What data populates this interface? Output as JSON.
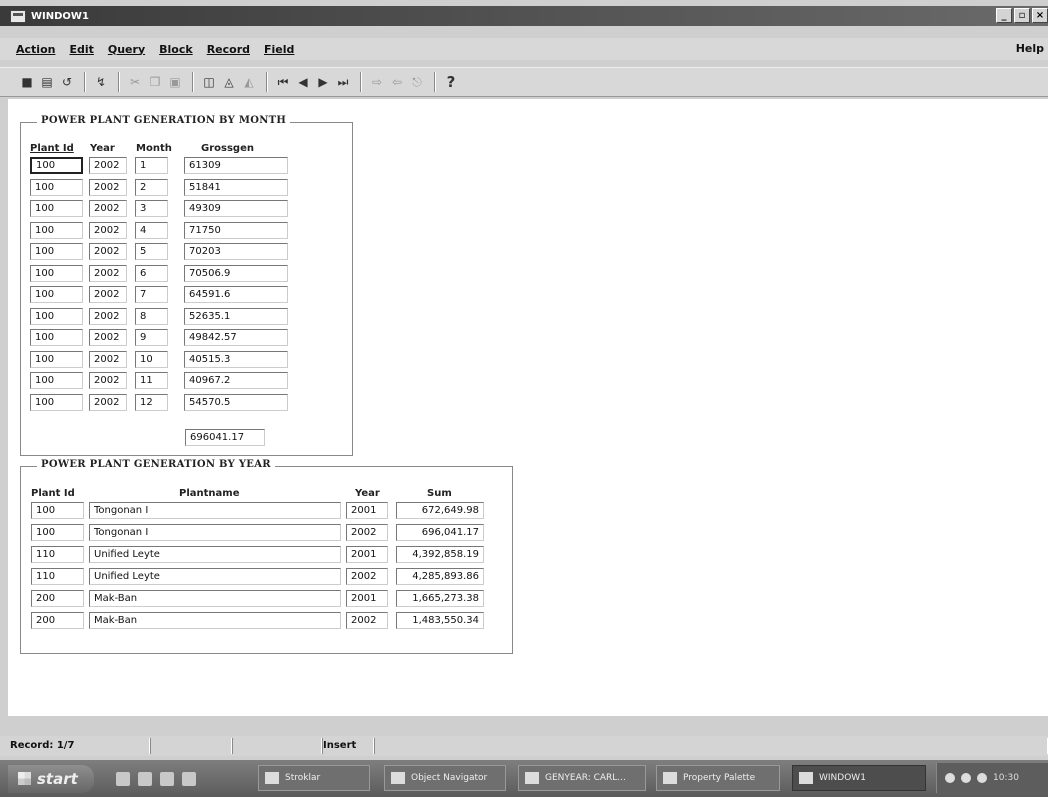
{
  "window": {
    "title": "WINDOW1",
    "btn_min": "_",
    "btn_max": "▫",
    "btn_close": "×"
  },
  "menu": {
    "items": [
      "Action",
      "Edit",
      "Query",
      "Block",
      "Record",
      "Field"
    ],
    "help": "Help"
  },
  "toolbar": {
    "icons": [
      "save-icon",
      "print-icon",
      "exit-icon",
      "insert-record-icon",
      "cut-icon",
      "copy-icon",
      "paste-icon",
      "enter-query-icon",
      "execute-query-icon",
      "cancel-query-icon",
      "first-record-icon",
      "previous-record-icon",
      "next-record-icon",
      "last-record-icon",
      "insert-new-icon",
      "delete-record-icon",
      "lock-record-icon",
      "help-icon"
    ],
    "help_glyph": "?"
  },
  "month_block": {
    "title": "POWER PLANT GENERATION BY MONTH",
    "headers": {
      "plant_id": "Plant Id",
      "year": "Year",
      "month": "Month",
      "grossgen": "Grossgen"
    },
    "rows": [
      {
        "plant_id": "100",
        "year": "2002",
        "month": "1",
        "grossgen": "61309"
      },
      {
        "plant_id": "100",
        "year": "2002",
        "month": "2",
        "grossgen": "51841"
      },
      {
        "plant_id": "100",
        "year": "2002",
        "month": "3",
        "grossgen": "49309"
      },
      {
        "plant_id": "100",
        "year": "2002",
        "month": "4",
        "grossgen": "71750"
      },
      {
        "plant_id": "100",
        "year": "2002",
        "month": "5",
        "grossgen": "70203"
      },
      {
        "plant_id": "100",
        "year": "2002",
        "month": "6",
        "grossgen": "70506.9"
      },
      {
        "plant_id": "100",
        "year": "2002",
        "month": "7",
        "grossgen": "64591.6"
      },
      {
        "plant_id": "100",
        "year": "2002",
        "month": "8",
        "grossgen": "52635.1"
      },
      {
        "plant_id": "100",
        "year": "2002",
        "month": "9",
        "grossgen": "49842.57"
      },
      {
        "plant_id": "100",
        "year": "2002",
        "month": "10",
        "grossgen": "40515.3"
      },
      {
        "plant_id": "100",
        "year": "2002",
        "month": "11",
        "grossgen": "40967.2"
      },
      {
        "plant_id": "100",
        "year": "2002",
        "month": "12",
        "grossgen": "54570.5"
      }
    ],
    "total": "696041.17"
  },
  "year_block": {
    "title": "POWER PLANT GENERATION BY YEAR",
    "headers": {
      "plant_id": "Plant Id",
      "plantname": "Plantname",
      "year": "Year",
      "sum": "Sum"
    },
    "rows": [
      {
        "plant_id": "100",
        "plantname": "Tongonan I",
        "year": "2001",
        "sum": "672,649.98"
      },
      {
        "plant_id": "100",
        "plantname": "Tongonan I",
        "year": "2002",
        "sum": "696,041.17"
      },
      {
        "plant_id": "110",
        "plantname": "Unified Leyte",
        "year": "2001",
        "sum": "4,392,858.19"
      },
      {
        "plant_id": "110",
        "plantname": "Unified Leyte",
        "year": "2002",
        "sum": "4,285,893.86"
      },
      {
        "plant_id": "200",
        "plantname": "Mak-Ban",
        "year": "2001",
        "sum": "1,665,273.38"
      },
      {
        "plant_id": "200",
        "plantname": "Mak-Ban",
        "year": "2002",
        "sum": "1,483,550.34"
      }
    ]
  },
  "status": {
    "record": "Record: 1/7",
    "mode": "Insert"
  },
  "taskbar": {
    "start": "start",
    "items": [
      "Stroklar",
      "Object Navigator",
      "GENYEAR: CARL...",
      "Property Palette",
      "WINDOW1"
    ],
    "clock": "10:30"
  }
}
